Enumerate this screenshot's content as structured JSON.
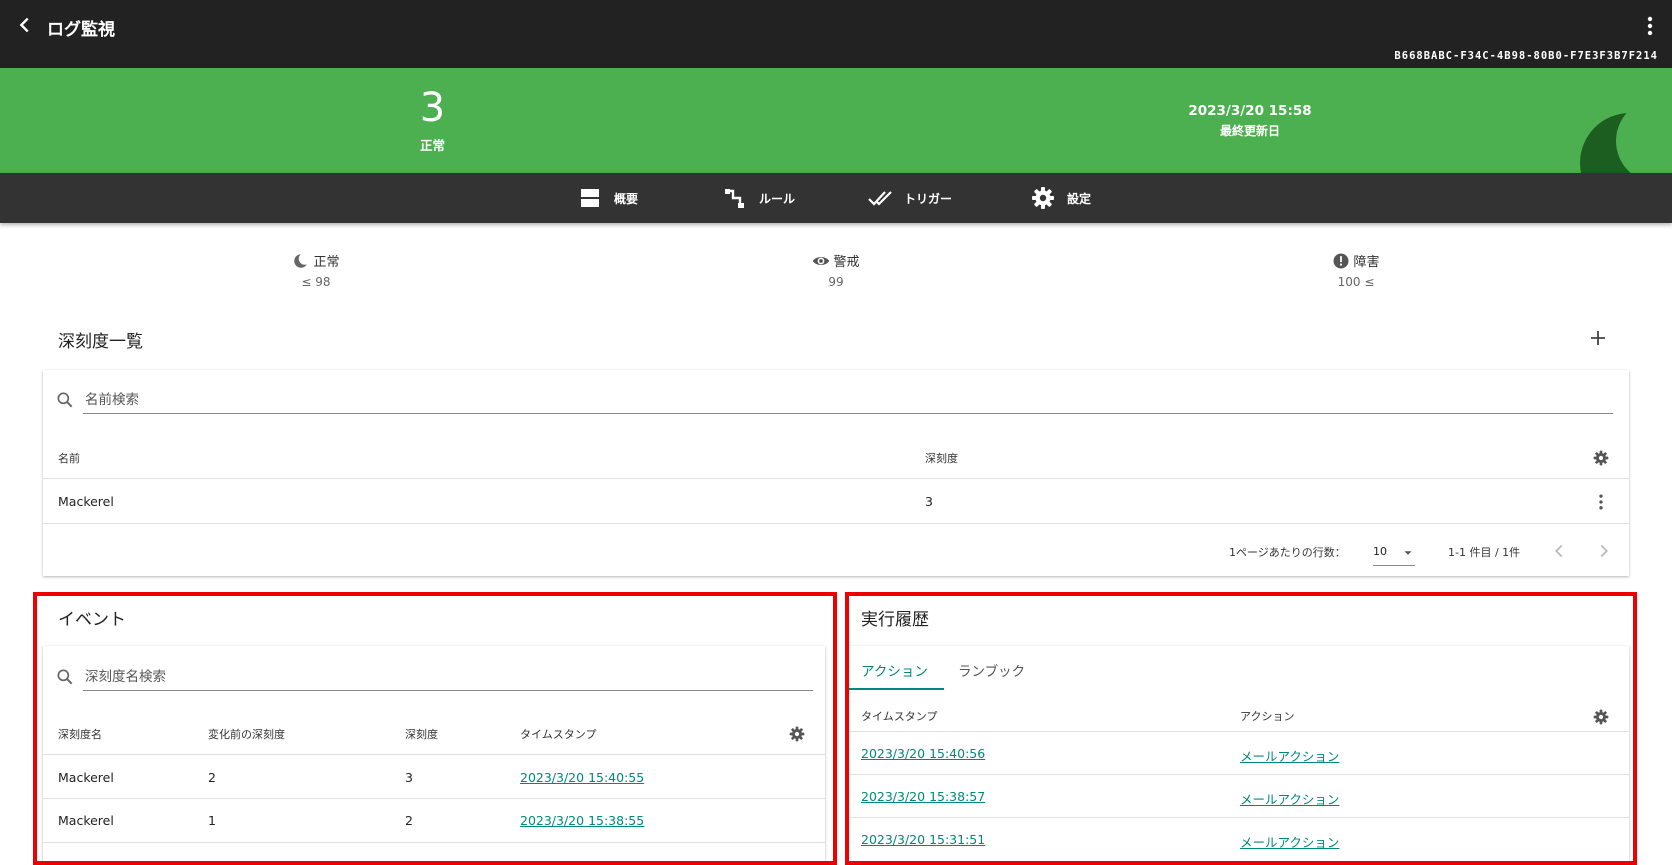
{
  "app": {
    "title": "ログ監視",
    "monitor_id": "B668BABC-F34C-4B98-80B0-F7E3F3B7F214"
  },
  "status": {
    "count": "3",
    "label": "正常",
    "updated_date": "2023/3/20 15:58",
    "updated_label": "最終更新日",
    "color": "#4caf50"
  },
  "nav": {
    "items": [
      {
        "label": "概要",
        "icon": "view-agenda-icon"
      },
      {
        "label": "ルール",
        "icon": "rule-flow-icon"
      },
      {
        "label": "トリガー",
        "icon": "double-check-icon"
      },
      {
        "label": "設定",
        "icon": "gear-icon"
      }
    ]
  },
  "thresholds": [
    {
      "label": "正常",
      "value": "≤ 98",
      "icon": "moon-icon"
    },
    {
      "label": "警戒",
      "value": "99",
      "icon": "eye-icon"
    },
    {
      "label": "障害",
      "value": "100 ≤",
      "icon": "alert-circle-icon"
    }
  ],
  "severity_list": {
    "title": "深刻度一覧",
    "search_placeholder": "名前検索",
    "columns": [
      "名前",
      "深刻度"
    ],
    "rows": [
      {
        "name": "Mackerel",
        "severity": "3"
      }
    ],
    "pagination": {
      "rows_per_page_label": "1ページあたりの行数：",
      "rows_per_page": "10",
      "range": "1-1 件目 / 1件"
    }
  },
  "events": {
    "title": "イベント",
    "search_placeholder": "深刻度名検索",
    "columns": [
      "深刻度名",
      "変化前の深刻度",
      "深刻度",
      "タイムスタンプ"
    ],
    "rows": [
      {
        "name": "Mackerel",
        "before": "2",
        "severity": "3",
        "timestamp": "2023/3/20 15:40:55"
      },
      {
        "name": "Mackerel",
        "before": "1",
        "severity": "2",
        "timestamp": "2023/3/20 15:38:55"
      }
    ]
  },
  "history": {
    "title": "実行履歴",
    "tabs": [
      "アクション",
      "ランブック"
    ],
    "columns": [
      "タイムスタンプ",
      "アクション"
    ],
    "rows": [
      {
        "timestamp": "2023/3/20 15:40:56",
        "action": "メールアクション"
      },
      {
        "timestamp": "2023/3/20 15:38:57",
        "action": "メールアクション"
      },
      {
        "timestamp": "2023/3/20 15:31:51",
        "action": "メールアクション"
      }
    ]
  },
  "colors": {
    "accent": "#00897b",
    "highlight": "#ee0000",
    "topbar": "#222222",
    "navbar": "#333333"
  }
}
